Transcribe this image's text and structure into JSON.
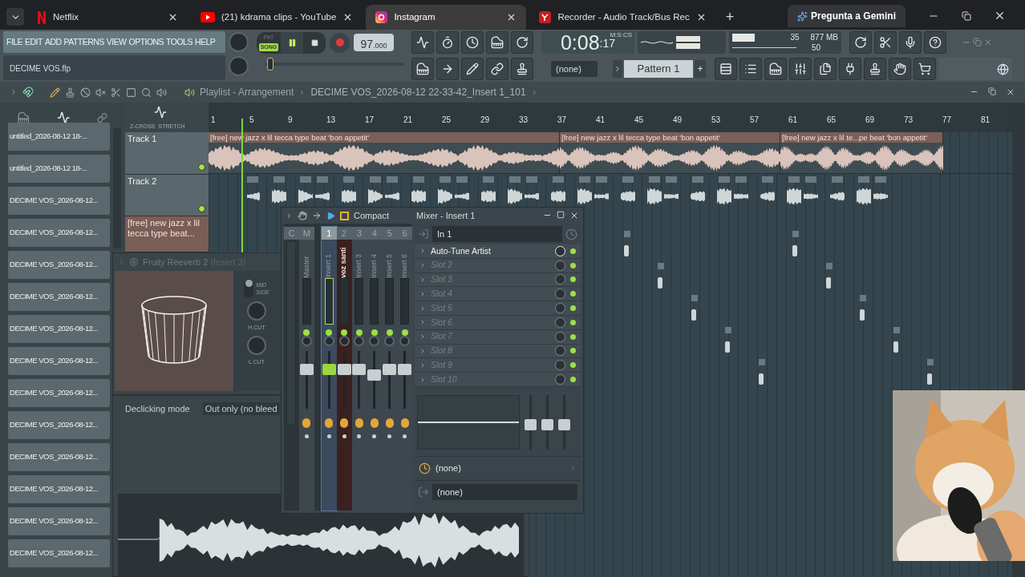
{
  "browser": {
    "tabs": [
      {
        "kind": "netflix",
        "title": "Netflix",
        "selected": false
      },
      {
        "kind": "youtube",
        "title": "(21) kdrama clips - YouTube",
        "selected": false
      },
      {
        "kind": "instagram",
        "title": "Instagram",
        "selected": true
      },
      {
        "kind": "recorder",
        "title": "Recorder - Audio Track/Bus Rec",
        "selected": false
      }
    ],
    "new_tab": "+",
    "gemini": "Pregunta a Gemini"
  },
  "menu": [
    "FILE",
    "EDIT",
    "ADD",
    "PATTERNS",
    "VIEW",
    "OPTIONS",
    "TOOLS",
    "HELP"
  ],
  "project": {
    "filename": "DECIME VOS.flp",
    "position": {
      "level": 0.02
    }
  },
  "transport": {
    "modes": [
      {
        "label": "PAT",
        "selected": false
      },
      {
        "label": "SONG",
        "selected": true
      }
    ],
    "playing": true,
    "tempo": "97",
    "tempo_decimals": ".000"
  },
  "time": {
    "value": "0:08",
    "centiseconds": ":17",
    "unit": "M:S:CS"
  },
  "monitor": {
    "polyphony": "35",
    "memory": "877 MB",
    "cpu": "50"
  },
  "pattern": {
    "channel": "(none)",
    "name": "Pattern 1",
    "add": "+"
  },
  "file_browser": {
    "items": [
      "untitled_2026-08-12 18-...",
      "untitled_2026-08-12 18-...",
      "DECIME VOS_2026-08-12...",
      "DECIME VOS_2026-08-12...",
      "DECIME VOS_2026-08-12...",
      "DECIME VOS_2026-08-12...",
      "DECIME VOS_2026-08-12...",
      "DECIME VOS_2026-08-12...",
      "DECIME VOS_2026-08-12...",
      "DECIME VOS_2026-08-12...",
      "DECIME VOS_2026-08-12...",
      "DECIME VOS_2026-08-12...",
      "DECIME VOS_2026-08-12...",
      "DECIME VOS_2026-08-12..."
    ]
  },
  "playlist": {
    "title": "Playlist - Arrangement",
    "path": "DECIME VOS_2026-08-12 22-33-42_Insert 1_101",
    "zcross": "Z-CROSS",
    "stretch": "STRETCH",
    "ruler": [
      "1",
      "5",
      "9",
      "13",
      "17",
      "21",
      "25",
      "29",
      "33",
      "37",
      "41",
      "45",
      "49",
      "53",
      "57",
      "61",
      "65",
      "69",
      "73",
      "77",
      "81"
    ],
    "tracks": [
      {
        "name": "Track 1"
      },
      {
        "name": "Track 2"
      },
      {
        "name": "[free] new jazz x lil tecca type beat..."
      }
    ],
    "clips": [
      "[free] new jazz x lil tecca type beat  'bon appetit'",
      "[free] new jazz x lil tecca type beat  'bon appetit'",
      "[free] new jazz x lil te...pe beat  'bon appetit'"
    ]
  },
  "reverb": {
    "title": "Fruity Reeverb 2",
    "insert": "(Insert 3)",
    "mid": "MID",
    "side": "SIDE",
    "hcut": "H.CUT",
    "lcut": "L.CUT",
    "side_mode": false
  },
  "editor": {
    "declick_label": "Declicking mode",
    "declick_value": "Out only (no bleed"
  },
  "mixer": {
    "compact": "Compact",
    "title": "Mixer - Insert 1",
    "current": "C",
    "strips": [
      {
        "number": "M",
        "name": "Master",
        "selected": false,
        "color": "#3d474d",
        "level": 0.72
      },
      {
        "number": "1",
        "name": "Insert 1",
        "selected": true,
        "color": "#3b4a5e",
        "level": 0.72
      },
      {
        "number": "2",
        "name": "voz santi",
        "selected": false,
        "color": "#3a211f",
        "level": 0.72
      },
      {
        "number": "3",
        "name": "Insert 3",
        "selected": false,
        "color": "#3d474d",
        "level": 0.72
      },
      {
        "number": "4",
        "name": "Insert 4",
        "selected": false,
        "color": "#3d474d",
        "level": 0.6
      },
      {
        "number": "5",
        "name": "Insert 5",
        "selected": false,
        "color": "#3d474d",
        "level": 0.72
      },
      {
        "number": "6",
        "name": "Insert 6",
        "selected": false,
        "color": "#3d474d",
        "level": 0.72
      }
    ],
    "input": "In 1",
    "slots": [
      {
        "name": "Auto-Tune Artist",
        "filled": true
      },
      {
        "name": "Slot 2",
        "filled": false
      },
      {
        "name": "Slot 3",
        "filled": false
      },
      {
        "name": "Slot 4",
        "filled": false
      },
      {
        "name": "Slot 5",
        "filled": false
      },
      {
        "name": "Slot 6",
        "filled": false
      },
      {
        "name": "Slot 7",
        "filled": false
      },
      {
        "name": "Slot 8",
        "filled": false
      },
      {
        "name": "Slot 9",
        "filled": false
      },
      {
        "name": "Slot 10",
        "filled": false
      }
    ],
    "eq_sliders": [
      {
        "level": 0.45
      },
      {
        "level": 0.45
      },
      {
        "level": 0.45
      }
    ],
    "sidechain": "(none)",
    "output": "(none)"
  }
}
